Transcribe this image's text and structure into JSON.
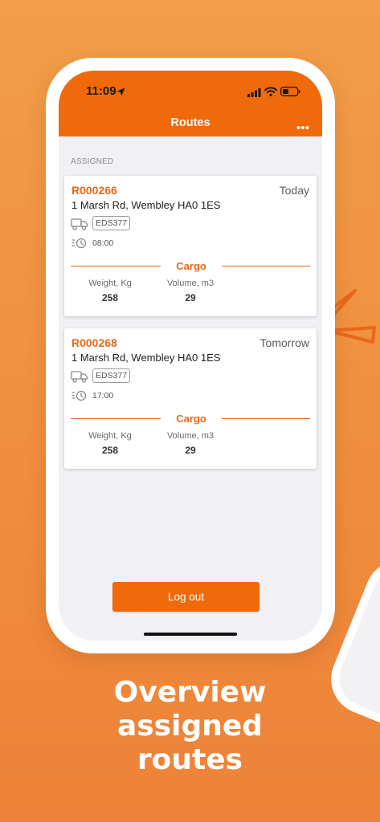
{
  "status_bar": {
    "time": "11:09"
  },
  "header": {
    "title": "Routes"
  },
  "section_label": "ASSIGNED",
  "routes": [
    {
      "id": "R000266",
      "when": "Today",
      "address": "1 Marsh Rd, Wembley HA0 1ES",
      "vehicle": "EDS377",
      "time": "08:00",
      "cargo_title": "Cargo",
      "weight_label": "Weight, Kg",
      "weight": "258",
      "volume_label": "Volume, m3",
      "volume": "29"
    },
    {
      "id": "R000268",
      "when": "Tomorrow",
      "address": "1 Marsh Rd, Wembley HA0 1ES",
      "vehicle": "EDS377",
      "time": "17:00",
      "cargo_title": "Cargo",
      "weight_label": "Weight, Kg",
      "weight": "258",
      "volume_label": "Volume, m3",
      "volume": "29"
    }
  ],
  "logout_label": "Log out",
  "tagline": [
    "Overview",
    "assigned",
    "routes"
  ],
  "colors": {
    "brand": "#F06A0C",
    "accent_text": "#E8681A",
    "background": "#F0913F"
  }
}
